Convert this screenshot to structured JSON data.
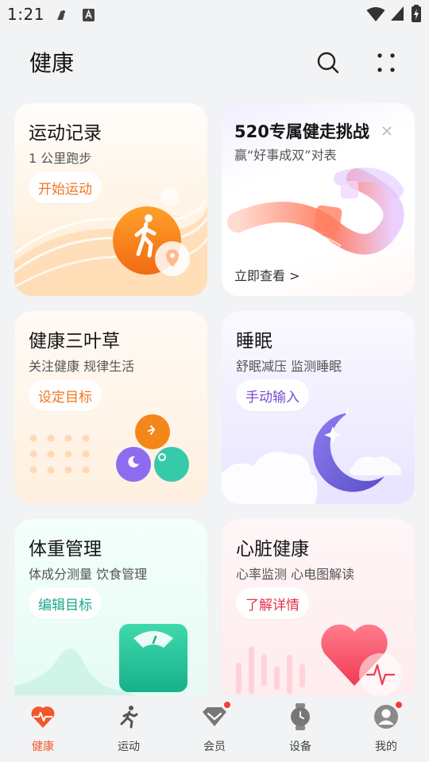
{
  "status_bar": {
    "time": "1:21"
  },
  "header": {
    "title": "健康"
  },
  "cards": {
    "sport": {
      "title": "运动记录",
      "subtitle": "1 公里跑步",
      "button": "开始运动",
      "accent": "#f07820"
    },
    "challenge": {
      "title": "520专属健走挑战",
      "subtitle": "赢“好事成双”对表",
      "link": "立即查看 >"
    },
    "clover": {
      "title": "健康三叶草",
      "subtitle": "关注健康 规律生活",
      "button": "设定目标",
      "accent": "#f07820"
    },
    "sleep": {
      "title": "睡眠",
      "subtitle": "舒眠减压 监测睡眠",
      "button": "手动输入",
      "accent": "#7a4bd0"
    },
    "weight": {
      "title": "体重管理",
      "subtitle": "体成分测量 饮食管理",
      "button": "编辑目标",
      "accent": "#1aa88a"
    },
    "heart": {
      "title": "心脏健康",
      "subtitle": "心率监测 心电图解读",
      "button": "了解详情",
      "accent": "#e8304a"
    }
  },
  "bottom_nav": {
    "items": [
      {
        "label": "健康",
        "icon": "heart-pulse-icon",
        "active": true
      },
      {
        "label": "运动",
        "icon": "runner-icon",
        "active": false
      },
      {
        "label": "会员",
        "icon": "diamond-icon",
        "active": false,
        "badge": true
      },
      {
        "label": "设备",
        "icon": "watch-icon",
        "active": false
      },
      {
        "label": "我的",
        "icon": "person-icon",
        "active": false,
        "badge": true
      }
    ]
  },
  "colors": {
    "active": "#f05a2a",
    "badge": "#f23c3c",
    "background": "#f1f3f5"
  }
}
